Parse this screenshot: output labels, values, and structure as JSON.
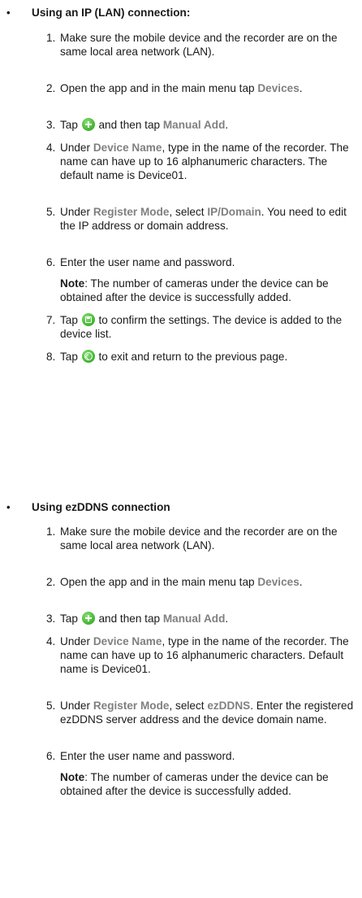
{
  "bullet_glyph": "•",
  "section1": {
    "heading": "Using an IP (LAN) connection:",
    "steps": [
      {
        "num": "1.",
        "text": "Make sure the mobile device and the recorder are on the same local area network (LAN)."
      },
      {
        "num": "2.",
        "pre": "Open the app and in the main menu tap ",
        "hl": "Devices",
        "post": "."
      },
      {
        "num": "3.",
        "pre": "Tap ",
        "mid": " and then tap ",
        "hl": "Manual Add",
        "post": ".",
        "icon": "add-circle-icon"
      },
      {
        "num": "4.",
        "pre": "Under ",
        "hl": "Device Name",
        "post": ", type in the name of the recorder. The name can have up to 16 alphanumeric characters. The default name is Device01."
      },
      {
        "num": "5.",
        "pre": "Under ",
        "hl": "Register Mode",
        "mid": ", select ",
        "hl2": "IP/Domain",
        "post": ". You need to edit the IP address or domain address."
      },
      {
        "num": "6.",
        "text": "Enter the user name and password."
      },
      {
        "num": "7.",
        "pre": "Tap ",
        "post": " to confirm the settings. The device is added to the device list.",
        "icon": "save-icon"
      },
      {
        "num": "8.",
        "pre": "Tap ",
        "post": " to exit and return to the previous page.",
        "icon": "back-icon"
      }
    ],
    "note_label": "Note",
    "note_text": ": The number of cameras under the device can be obtained after the device is successfully added."
  },
  "section2": {
    "heading": "Using ezDDNS connection",
    "steps": [
      {
        "num": "1.",
        "text": "Make sure the mobile device and the recorder are on the same local area network (LAN)."
      },
      {
        "num": "2.",
        "pre": "Open the app and in the main menu tap ",
        "hl": "Devices",
        "post": "."
      },
      {
        "num": "3.",
        "pre": "Tap ",
        "mid": " and then tap ",
        "hl": "Manual Add",
        "post": ".",
        "icon": "add-circle-icon"
      },
      {
        "num": "4.",
        "pre": "Under ",
        "hl": "Device Name",
        "post": ", type in the name of the recorder. The name can have up to 16 alphanumeric characters. Default name is Device01."
      },
      {
        "num": "5.",
        "pre": "Under ",
        "hl": "Register Mode",
        "mid": ", select ",
        "hl2": "ezDDNS",
        "post": ". Enter the registered ezDDNS server address and the device domain name."
      },
      {
        "num": "6.",
        "text": "Enter the user name and password."
      }
    ],
    "note_label": "Note",
    "note_text": ": The number of cameras under the device can be obtained after the device is successfully added."
  },
  "colors": {
    "highlight": "#808080",
    "icon_green": "#4dbb3a",
    "text": "#1a1a1a"
  }
}
